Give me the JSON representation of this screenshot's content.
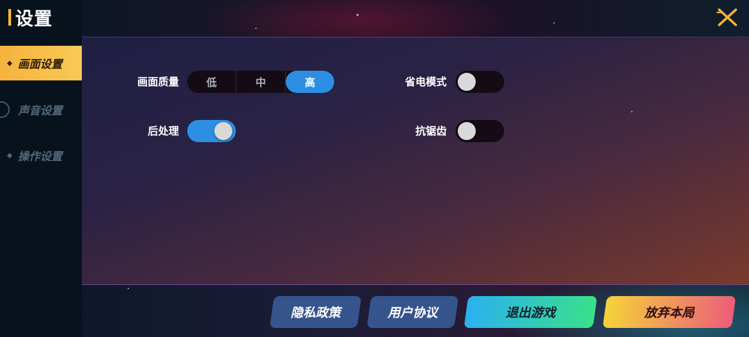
{
  "header": {
    "title": "设置",
    "close_icon": "close-x-icon"
  },
  "sidebar": {
    "items": [
      {
        "label": "画面设置",
        "active": true
      },
      {
        "label": "声音设置",
        "active": false
      },
      {
        "label": "操作设置",
        "active": false
      }
    ]
  },
  "settings": {
    "quality": {
      "label": "画面质量",
      "options": [
        "低",
        "中",
        "高"
      ],
      "selected": "高"
    },
    "power_saving": {
      "label": "省电模式",
      "on": false
    },
    "post_processing": {
      "label": "后处理",
      "on": true
    },
    "anti_aliasing": {
      "label": "抗锯齿",
      "on": false
    }
  },
  "buttons": {
    "privacy": "隐私政策",
    "agreement": "用户协议",
    "exit_game": "退出游戏",
    "abandon": "放弃本局"
  },
  "colors": {
    "accent": "#f6b23c",
    "toggle_on": "#2d8fe3",
    "toggle_off": "#150b14"
  }
}
